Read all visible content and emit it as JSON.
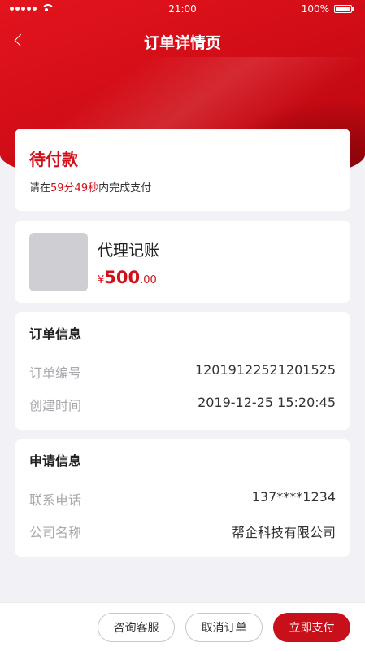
{
  "status_bar": {
    "time": "21:00",
    "battery": "100%"
  },
  "nav": {
    "title": "订单详情页"
  },
  "order_status": {
    "title": "待付款",
    "desc_prefix": "请在",
    "countdown": "59分49秒",
    "desc_suffix": "内完成支付"
  },
  "product": {
    "name": "代理记账",
    "currency": "¥",
    "price_int": "500",
    "price_dec": ".00"
  },
  "order_info": {
    "title": "订单信息",
    "rows": [
      {
        "label": "订单编号",
        "value": "12019122521201525"
      },
      {
        "label": "创建时间",
        "value": "2019-12-25  15:20:45"
      }
    ]
  },
  "apply_info": {
    "title": "申请信息",
    "rows": [
      {
        "label": "联系电话",
        "value": "137****1234"
      },
      {
        "label": "公司名称",
        "value": "帮企科技有限公司"
      }
    ]
  },
  "actions": {
    "service": "咨询客服",
    "cancel": "取消订单",
    "pay": "立即支付"
  },
  "colors": {
    "accent": "#d10f1a",
    "background": "#f2f1f6"
  }
}
